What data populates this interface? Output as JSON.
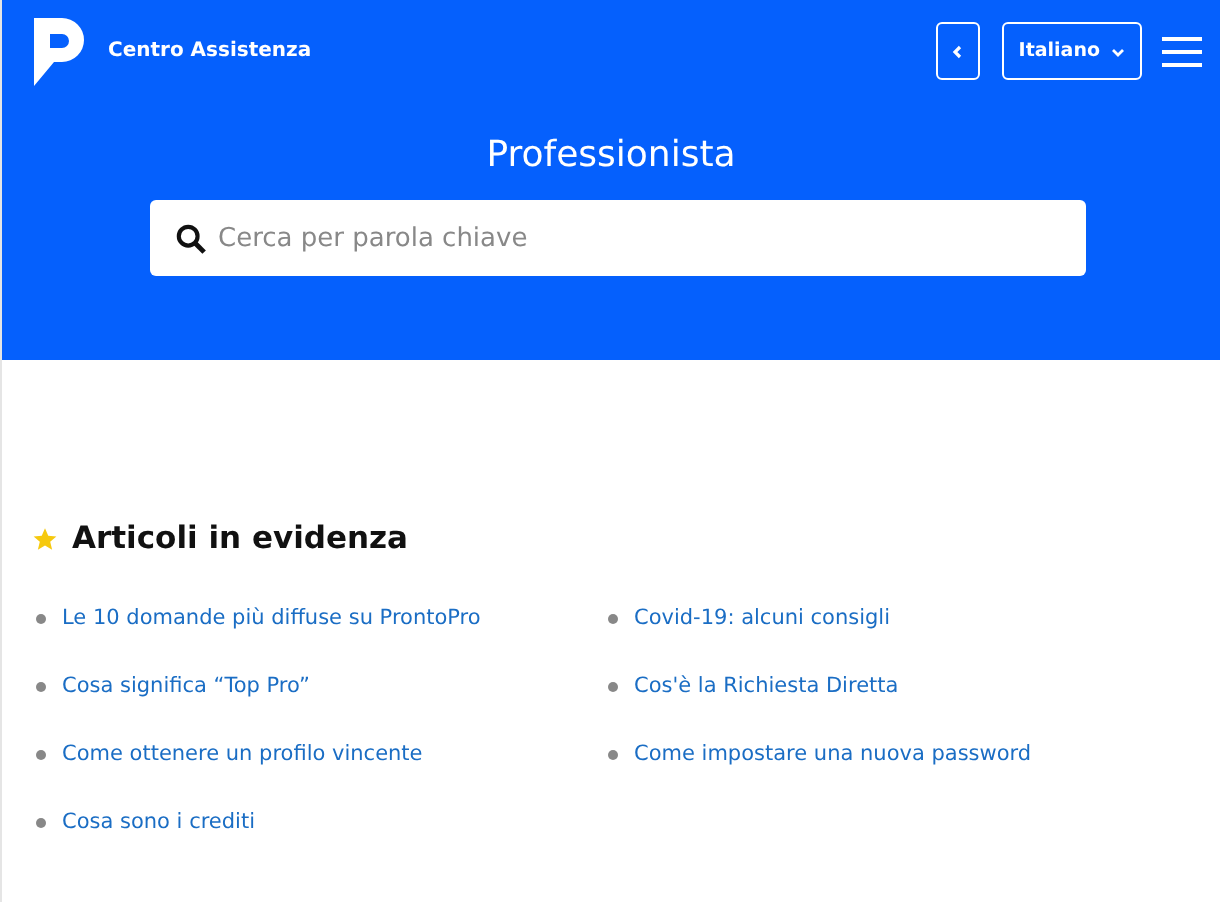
{
  "header": {
    "brand": "Centro Assistenza",
    "language": "Italiano"
  },
  "hero": {
    "title": "Professionista",
    "search": {
      "placeholder": "Cerca per parola chiave"
    }
  },
  "featured": {
    "title": "Articoli in evidenza",
    "columns": [
      [
        "Le 10 domande più diffuse su ProntoPro",
        "Cosa significa “Top Pro”",
        "Come ottenere un profilo vincente",
        "Cosa sono i crediti"
      ],
      [
        "Covid-19: alcuni consigli",
        "Cos'è la Richiesta Diretta",
        "Come impostare una nuova password"
      ]
    ]
  }
}
